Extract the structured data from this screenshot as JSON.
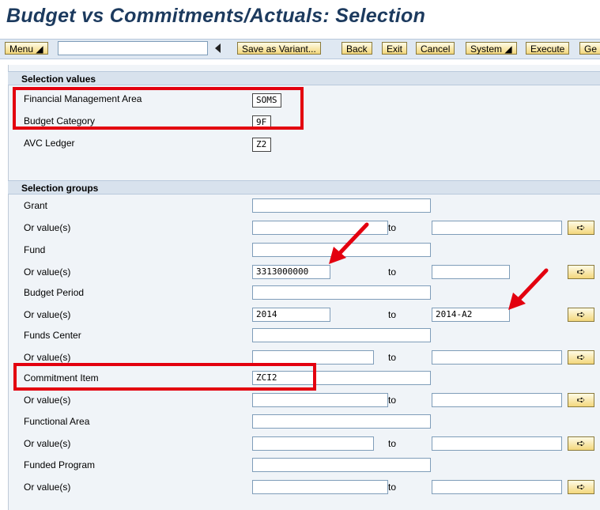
{
  "title": "Budget vs Commitments/Actuals: Selection",
  "toolbar": {
    "menu_label": "Menu ◢",
    "buttons": [
      "Save as Variant...",
      "Back",
      "Exit",
      "Cancel",
      "System ◢",
      "Execute",
      "Ge"
    ]
  },
  "selection_values": {
    "header": "Selection values",
    "rows": [
      {
        "label": "Financial Management Area",
        "value": "SOMS"
      },
      {
        "label": "Budget Category",
        "value": "9F"
      },
      {
        "label": "AVC Ledger",
        "value": "Z2"
      }
    ]
  },
  "selection_groups": {
    "header": "Selection groups",
    "to_label": "to",
    "rows": [
      {
        "label": "Grant",
        "value": ""
      },
      {
        "label": "Or value(s)",
        "from": "",
        "to": ""
      },
      {
        "label": "Fund",
        "value": ""
      },
      {
        "label": "Or value(s)",
        "from": "3313000000",
        "to": ""
      },
      {
        "label": "Budget Period",
        "value": ""
      },
      {
        "label": "Or value(s)",
        "from": "2014",
        "to": "2014-A2"
      },
      {
        "label": "Funds Center",
        "value": ""
      },
      {
        "label": "Or value(s)",
        "from": "",
        "to": ""
      },
      {
        "label": "Commitment Item",
        "value": "ZCI2"
      },
      {
        "label": "Or value(s)",
        "from": "",
        "to": ""
      },
      {
        "label": "Functional Area",
        "value": ""
      },
      {
        "label": "Or value(s)",
        "from": "",
        "to": ""
      },
      {
        "label": "Funded Program",
        "value": ""
      },
      {
        "label": "Or value(s)",
        "from": "",
        "to": ""
      }
    ]
  },
  "icons": {
    "multiple_selection": "arrow-right-icon",
    "back_arrow": "triangle-left-icon"
  },
  "colors": {
    "highlight": "#e3000f",
    "title": "#1c3a5e",
    "button_fill": "#f3d77c"
  }
}
